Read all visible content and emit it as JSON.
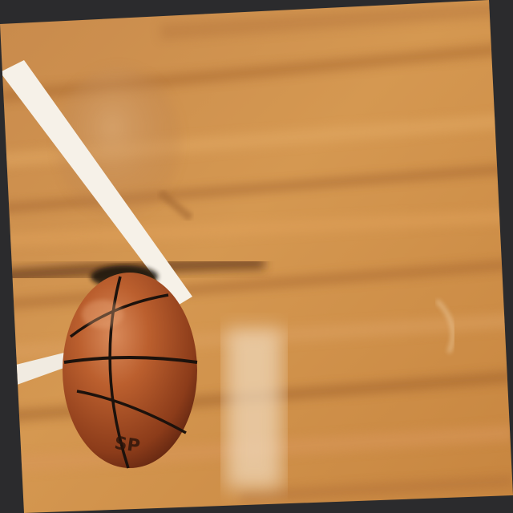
{
  "scene": {
    "subject": "basketball",
    "setting": "hardwood court",
    "ball_brand_text": "SP",
    "colors": {
      "floor_light": "#d79a52",
      "floor_mid": "#b8763a",
      "floor_dark": "#8a5425",
      "ball_main": "#b55a2c",
      "ball_shadow": "#6e2e14",
      "seam": "#1c120c",
      "court_line": "#f4efe6",
      "border": "#2b2b2d"
    }
  }
}
